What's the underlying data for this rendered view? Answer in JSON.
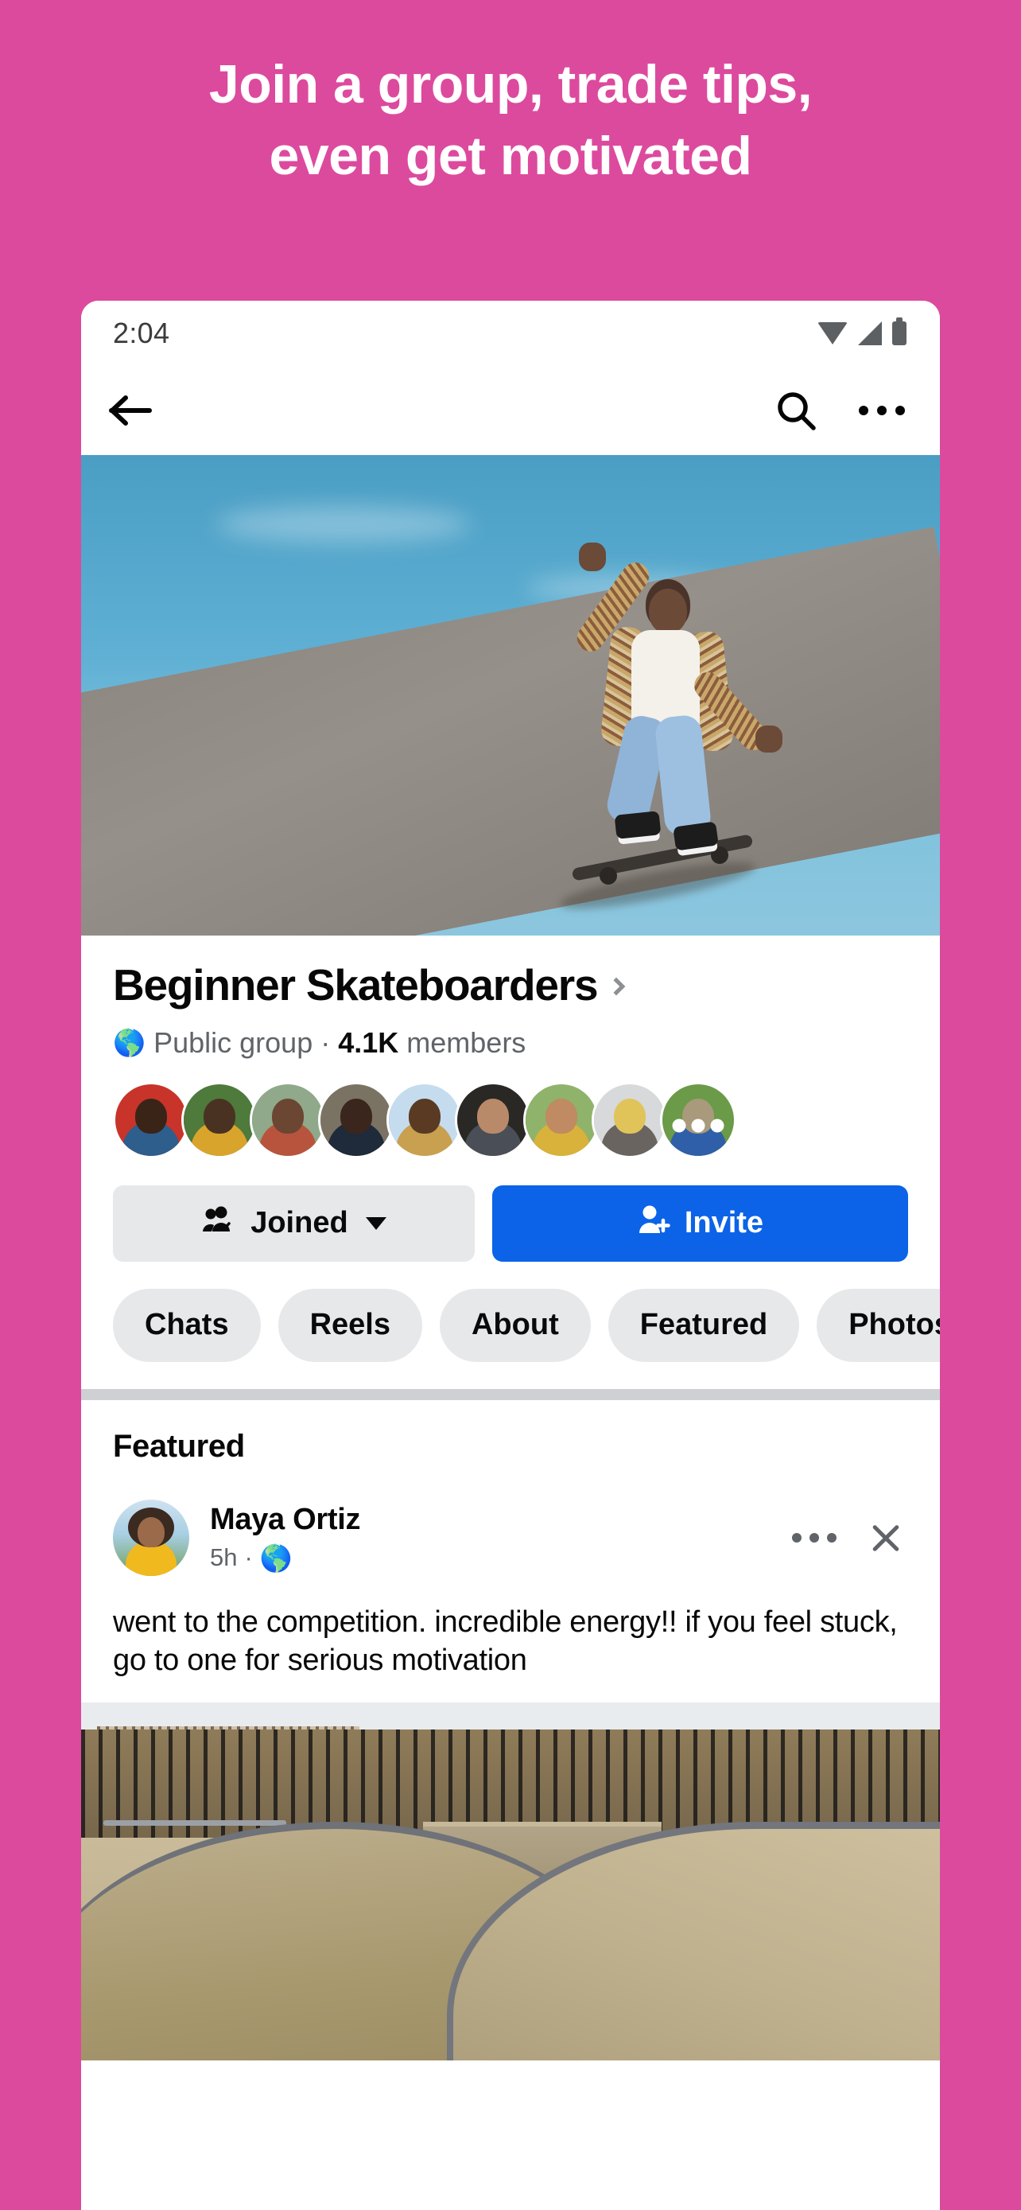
{
  "theme": {
    "promo_background": "#dc4a9e",
    "promo_text_color": "#ffffff",
    "primary_button": "#0c63e7",
    "pill_background": "#e7e8ea",
    "divider": "#ced0d4"
  },
  "promo": {
    "headline_line1": "Join a group, trade tips,",
    "headline_line2": "even get motivated"
  },
  "status_bar": {
    "time": "2:04",
    "icons": [
      "wifi-icon",
      "cellular-signal-icon",
      "battery-icon"
    ]
  },
  "navbar": {
    "back_icon": "back-arrow-icon",
    "search_icon": "search-icon",
    "menu_icon": "more-options-icon"
  },
  "cover": {
    "alt": "skateboarder-riding-down-ramp-against-blue-sky"
  },
  "group": {
    "name": "Beginner Skateboarders",
    "chevron_icon": "chevron-right-icon",
    "privacy_icon": "globe-icon",
    "privacy": "Public group",
    "separator": "·",
    "member_count": "4.1K",
    "member_label": "members",
    "members": [
      {
        "name": "member-1",
        "bg": "#c8342a",
        "head": "#3a2418",
        "body": "#2d5e8c"
      },
      {
        "name": "member-2",
        "bg": "#4e7a3c",
        "head": "#4a3222",
        "body": "#d8a42c"
      },
      {
        "name": "member-3",
        "bg": "#8fa98a",
        "head": "#6b4632",
        "body": "#b8543e"
      },
      {
        "name": "member-4",
        "bg": "#7a7364",
        "head": "#3a261c",
        "body": "#1f2a3a"
      },
      {
        "name": "member-5",
        "bg": "#c5dcef",
        "head": "#5a3a22",
        "body": "#c8a050"
      },
      {
        "name": "member-6",
        "bg": "#2a2824",
        "head": "#b98a6a",
        "body": "#4a4e56"
      },
      {
        "name": "member-7",
        "bg": "#8fb36a",
        "head": "#c08a62",
        "body": "#d8b23a"
      },
      {
        "name": "member-8",
        "bg": "#d7d9db",
        "head": "#e0c45a",
        "body": "#6a6460"
      },
      {
        "name": "member-9-overflow",
        "bg": "#6b9a48",
        "head": "#a89a7a",
        "body": "#2f5fa8",
        "overflow": true
      }
    ]
  },
  "actions": {
    "joined_icon": "group-members-check-icon",
    "joined_label": "Joined",
    "joined_caret_icon": "caret-down-icon",
    "invite_icon": "person-add-icon",
    "invite_label": "Invite"
  },
  "tabs": [
    {
      "label": "Chats"
    },
    {
      "label": "Reels"
    },
    {
      "label": "About"
    },
    {
      "label": "Featured"
    },
    {
      "label": "Photos"
    }
  ],
  "featured": {
    "section_title": "Featured",
    "post": {
      "author": "Maya Ortiz",
      "timestamp": "5h",
      "separator": "·",
      "audience_icon": "globe-icon",
      "more_icon": "more-options-icon",
      "close_icon": "close-icon",
      "body": "went to the competition. incredible energy!! if you feel stuck, go to one for serious motivation",
      "image_alt": "concrete-skatepark-bowl-and-ramps"
    }
  }
}
